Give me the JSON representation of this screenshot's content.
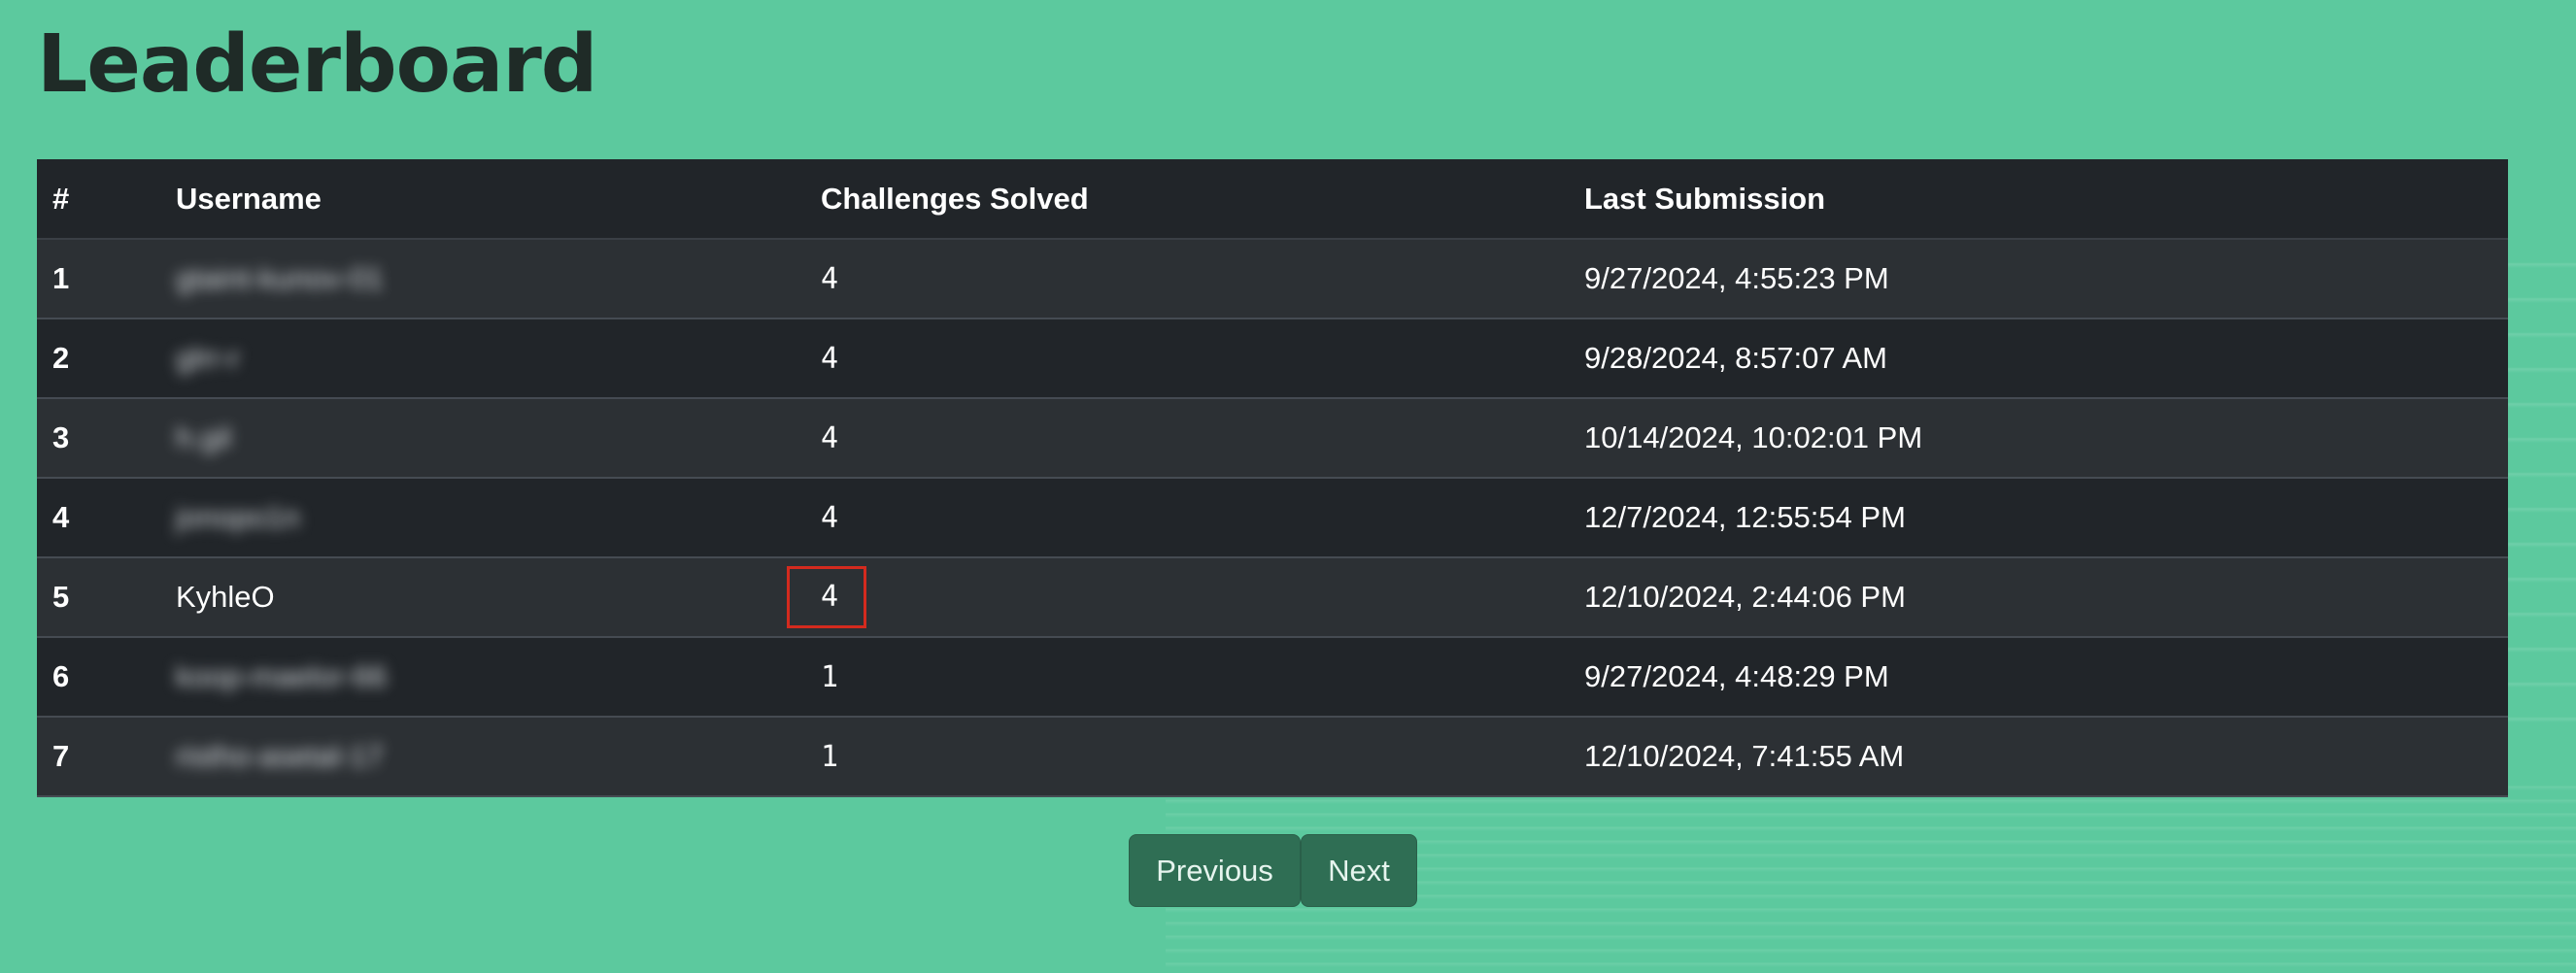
{
  "page": {
    "title": "Leaderboard",
    "accent_bg": "#5cc99e",
    "table_dark": "#212529",
    "table_light": "#2c3034",
    "highlight": "#d42a1e"
  },
  "table": {
    "headers": [
      "#",
      "Username",
      "Challenges Solved",
      "Last Submission"
    ],
    "rows": [
      {
        "rank": "1",
        "username": "gtaint-kunov-01",
        "username_blurred": true,
        "solved": "4",
        "last": "9/27/2024, 4:55:23 PM"
      },
      {
        "rank": "2",
        "username": "glrr-r",
        "username_blurred": true,
        "solved": "4",
        "last": "9/28/2024, 8:57:07 AM"
      },
      {
        "rank": "3",
        "username": "h.gil",
        "username_blurred": true,
        "solved": "4",
        "last": "10/14/2024, 10:02:01 PM"
      },
      {
        "rank": "4",
        "username": "jonopo1n",
        "username_blurred": true,
        "solved": "4",
        "last": "12/7/2024, 12:55:54 PM"
      },
      {
        "rank": "5",
        "username": "KyhleO",
        "username_blurred": false,
        "solved": "4",
        "solved_highlighted": true,
        "last": "12/10/2024, 2:44:06 PM"
      },
      {
        "rank": "6",
        "username": "koop-maelor-66",
        "username_blurred": true,
        "solved": "1",
        "last": "9/27/2024, 4:48:29 PM"
      },
      {
        "rank": "7",
        "username": "ristho-asetal-17",
        "username_blurred": true,
        "solved": "1",
        "last": "12/10/2024, 7:41:55 AM"
      }
    ]
  },
  "pagination": {
    "previous_label": "Previous",
    "next_label": "Next"
  }
}
